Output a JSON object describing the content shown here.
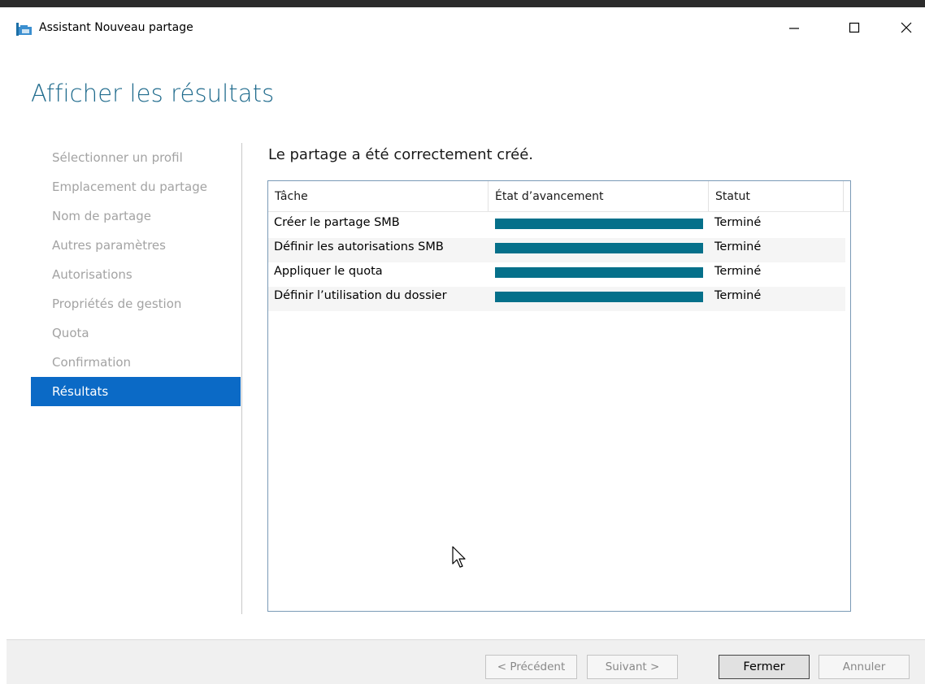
{
  "window": {
    "title": "Assistant Nouveau partage",
    "controls": [
      "minimize-icon",
      "maximize-icon",
      "close-icon"
    ]
  },
  "page": {
    "heading": "Afficher les résultats",
    "message": "Le partage a été correctement créé."
  },
  "nav": {
    "items": [
      {
        "label": "Sélectionner un profil",
        "active": false
      },
      {
        "label": "Emplacement du partage",
        "active": false
      },
      {
        "label": "Nom de partage",
        "active": false
      },
      {
        "label": "Autres paramètres",
        "active": false
      },
      {
        "label": "Autorisations",
        "active": false
      },
      {
        "label": "Propriétés de gestion",
        "active": false
      },
      {
        "label": "Quota",
        "active": false
      },
      {
        "label": "Confirmation",
        "active": false
      },
      {
        "label": "Résultats",
        "active": true
      }
    ]
  },
  "table": {
    "headers": [
      "Tâche",
      "État d’avancement",
      "Statut"
    ],
    "rows": [
      {
        "task": "Créer le partage SMB",
        "progress": 1.0,
        "status": "Terminé"
      },
      {
        "task": "Définir les autorisations SMB",
        "progress": 1.0,
        "status": "Terminé"
      },
      {
        "task": "Appliquer le quota",
        "progress": 1.0,
        "status": "Terminé"
      },
      {
        "task": "Définir l’utilisation du dossier",
        "progress": 1.0,
        "status": "Terminé"
      }
    ]
  },
  "footer": {
    "prev": "< Précédent",
    "next": "Suivant >",
    "close": "Fermer",
    "cancel": "Annuler"
  },
  "colors": {
    "heading": "#1e6a8c",
    "active_nav": "#0b6ac6",
    "progress": "#05708a"
  }
}
